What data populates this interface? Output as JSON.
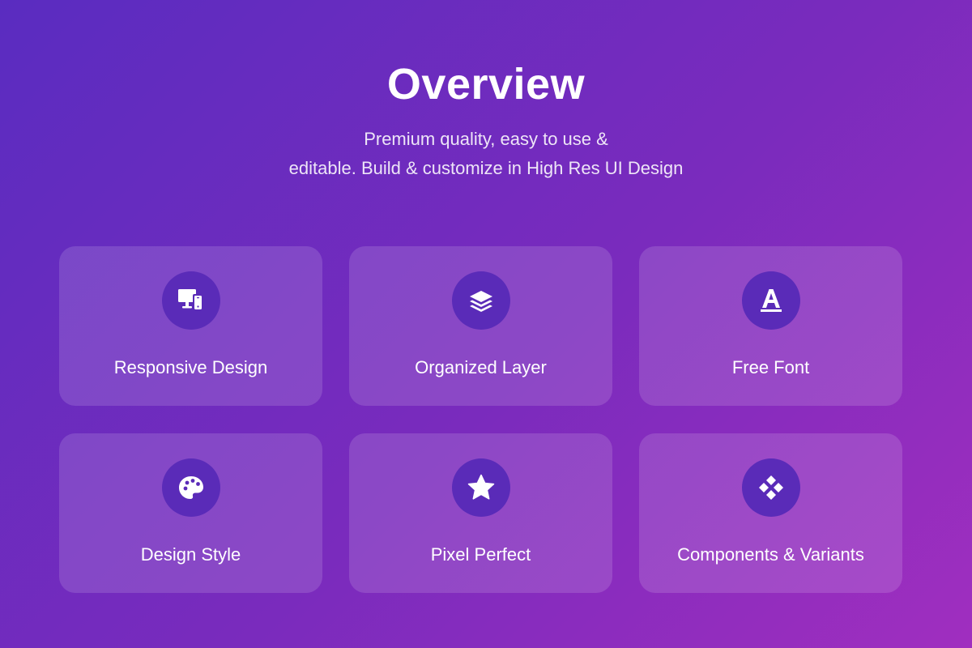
{
  "header": {
    "title": "Overview",
    "subtitle_line1": "Premium quality, easy to use &",
    "subtitle_line2": "editable. Build & customize in High Res UI Design"
  },
  "features": [
    {
      "label": "Responsive Design",
      "icon": "devices-icon"
    },
    {
      "label": "Organized Layer",
      "icon": "layers-icon"
    },
    {
      "label": "Free Font",
      "icon": "font-icon"
    },
    {
      "label": "Design Style",
      "icon": "palette-icon"
    },
    {
      "label": "Pixel Perfect",
      "icon": "star-icon"
    },
    {
      "label": "Components & Variants",
      "icon": "components-icon"
    }
  ],
  "colors": {
    "icon_circle": "#5a2bb8",
    "background_start": "#5a2cc0",
    "background_end": "#a02ebf"
  }
}
